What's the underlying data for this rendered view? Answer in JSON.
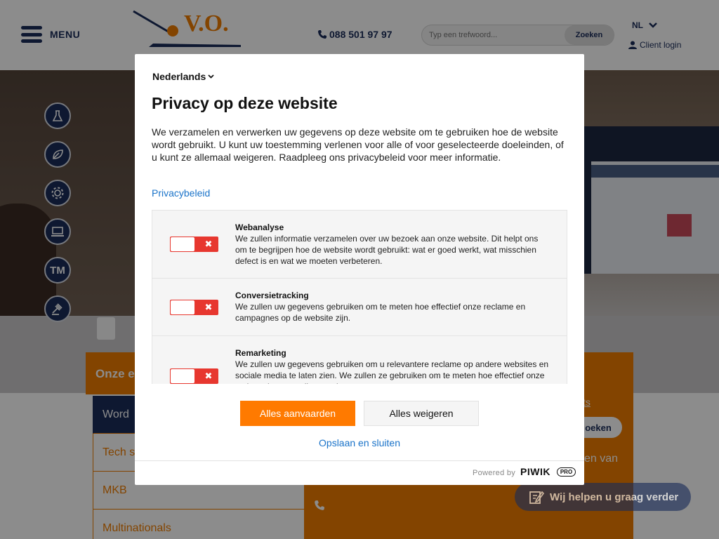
{
  "header": {
    "menu_label": "MENU",
    "logo_text": "V.O.",
    "phone": "088 501 97 97",
    "search_placeholder": "Typ een trefwoord...",
    "search_button": "Zoeken",
    "language": "NL",
    "client_login": "Client login"
  },
  "sidebar_icons": [
    "lab-flask-icon",
    "leaf-icon",
    "gear-icon",
    "laptop-icon",
    "TM",
    "gavel-icon"
  ],
  "expertise": {
    "title_visible": "Onze e",
    "items": [
      "Word",
      "Tech s",
      "MKB",
      "Multinationals"
    ]
  },
  "right_panel": {
    "link_fragment": "ts",
    "button_fragment": "oeken",
    "text_fragment": "en van"
  },
  "help_button": "Wij helpen u graag verder",
  "consent": {
    "language": "Nederlands",
    "title": "Privacy op deze website",
    "description": "We verzamelen en verwerken uw gegevens op deze website om te gebruiken hoe de website wordt gebruikt. U kunt uw toestemming verlenen voor alle of voor geselecteerde doeleinden, of u kunt ze allemaal weigeren. Raadpleeg ons privacybeleid voor meer informatie.",
    "privacy_link": "Privacybeleid",
    "categories": [
      {
        "name": "Webanalyse",
        "description": "We zullen informatie verzamelen over uw bezoek aan onze website. Dit helpt ons om te begrijpen hoe de website wordt gebruikt: wat er goed werkt, wat misschien defect is en wat we moeten verbeteren.",
        "enabled": false
      },
      {
        "name": "Conversietracking",
        "description": "We zullen uw gegevens gebruiken om te meten hoe effectief onze reclame en campagnes op de website zijn.",
        "enabled": false
      },
      {
        "name": "Remarketing",
        "description": "We zullen uw gegevens gebruiken om u relevantere reclame op andere websites en sociale media te laten zien. We zullen ze gebruiken om te meten hoe effectief onze reclame is en om die te verbeteren voor u.",
        "enabled": false
      }
    ],
    "toggle_off_symbol": "✖",
    "accept_all": "Alles aanvaarden",
    "reject_all": "Alles weigeren",
    "save_close": "Opslaan en sluiten",
    "powered_by": "Powered by",
    "brand": "PIWIK",
    "brand_badge": "PRO"
  },
  "colors": {
    "navy": "#1a2c5a",
    "orange": "#ef7d00",
    "accept_orange": "#ff7a00",
    "toggle_red": "#e7372f",
    "link_blue": "#1a73c9"
  }
}
